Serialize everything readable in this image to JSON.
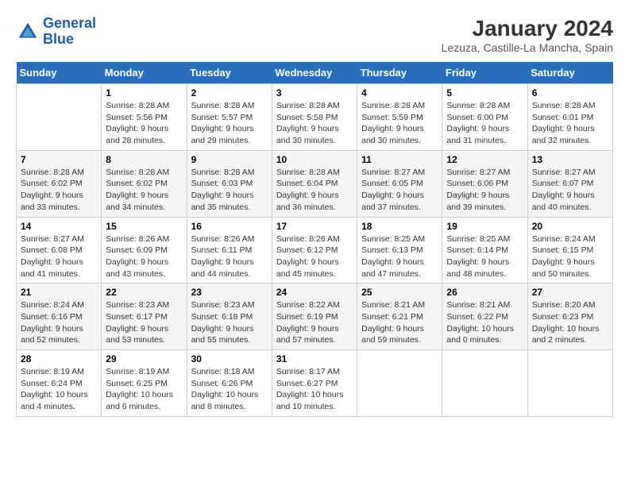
{
  "logo": {
    "line1": "General",
    "line2": "Blue"
  },
  "title": "January 2024",
  "subtitle": "Lezuza, Castille-La Mancha, Spain",
  "days_header": [
    "Sunday",
    "Monday",
    "Tuesday",
    "Wednesday",
    "Thursday",
    "Friday",
    "Saturday"
  ],
  "weeks": [
    [
      {
        "day": "",
        "sunrise": "",
        "sunset": "",
        "daylight": ""
      },
      {
        "day": "1",
        "sunrise": "Sunrise: 8:28 AM",
        "sunset": "Sunset: 5:56 PM",
        "daylight": "Daylight: 9 hours and 28 minutes."
      },
      {
        "day": "2",
        "sunrise": "Sunrise: 8:28 AM",
        "sunset": "Sunset: 5:57 PM",
        "daylight": "Daylight: 9 hours and 29 minutes."
      },
      {
        "day": "3",
        "sunrise": "Sunrise: 8:28 AM",
        "sunset": "Sunset: 5:58 PM",
        "daylight": "Daylight: 9 hours and 30 minutes."
      },
      {
        "day": "4",
        "sunrise": "Sunrise: 8:28 AM",
        "sunset": "Sunset: 5:59 PM",
        "daylight": "Daylight: 9 hours and 30 minutes."
      },
      {
        "day": "5",
        "sunrise": "Sunrise: 8:28 AM",
        "sunset": "Sunset: 6:00 PM",
        "daylight": "Daylight: 9 hours and 31 minutes."
      },
      {
        "day": "6",
        "sunrise": "Sunrise: 8:28 AM",
        "sunset": "Sunset: 6:01 PM",
        "daylight": "Daylight: 9 hours and 32 minutes."
      }
    ],
    [
      {
        "day": "7",
        "sunrise": "Sunrise: 8:28 AM",
        "sunset": "Sunset: 6:02 PM",
        "daylight": "Daylight: 9 hours and 33 minutes."
      },
      {
        "day": "8",
        "sunrise": "Sunrise: 8:28 AM",
        "sunset": "Sunset: 6:02 PM",
        "daylight": "Daylight: 9 hours and 34 minutes."
      },
      {
        "day": "9",
        "sunrise": "Sunrise: 8:28 AM",
        "sunset": "Sunset: 6:03 PM",
        "daylight": "Daylight: 9 hours and 35 minutes."
      },
      {
        "day": "10",
        "sunrise": "Sunrise: 8:28 AM",
        "sunset": "Sunset: 6:04 PM",
        "daylight": "Daylight: 9 hours and 36 minutes."
      },
      {
        "day": "11",
        "sunrise": "Sunrise: 8:27 AM",
        "sunset": "Sunset: 6:05 PM",
        "daylight": "Daylight: 9 hours and 37 minutes."
      },
      {
        "day": "12",
        "sunrise": "Sunrise: 8:27 AM",
        "sunset": "Sunset: 6:06 PM",
        "daylight": "Daylight: 9 hours and 39 minutes."
      },
      {
        "day": "13",
        "sunrise": "Sunrise: 8:27 AM",
        "sunset": "Sunset: 6:07 PM",
        "daylight": "Daylight: 9 hours and 40 minutes."
      }
    ],
    [
      {
        "day": "14",
        "sunrise": "Sunrise: 8:27 AM",
        "sunset": "Sunset: 6:08 PM",
        "daylight": "Daylight: 9 hours and 41 minutes."
      },
      {
        "day": "15",
        "sunrise": "Sunrise: 8:26 AM",
        "sunset": "Sunset: 6:09 PM",
        "daylight": "Daylight: 9 hours and 43 minutes."
      },
      {
        "day": "16",
        "sunrise": "Sunrise: 8:26 AM",
        "sunset": "Sunset: 6:11 PM",
        "daylight": "Daylight: 9 hours and 44 minutes."
      },
      {
        "day": "17",
        "sunrise": "Sunrise: 8:26 AM",
        "sunset": "Sunset: 6:12 PM",
        "daylight": "Daylight: 9 hours and 45 minutes."
      },
      {
        "day": "18",
        "sunrise": "Sunrise: 8:25 AM",
        "sunset": "Sunset: 6:13 PM",
        "daylight": "Daylight: 9 hours and 47 minutes."
      },
      {
        "day": "19",
        "sunrise": "Sunrise: 8:25 AM",
        "sunset": "Sunset: 6:14 PM",
        "daylight": "Daylight: 9 hours and 48 minutes."
      },
      {
        "day": "20",
        "sunrise": "Sunrise: 8:24 AM",
        "sunset": "Sunset: 6:15 PM",
        "daylight": "Daylight: 9 hours and 50 minutes."
      }
    ],
    [
      {
        "day": "21",
        "sunrise": "Sunrise: 8:24 AM",
        "sunset": "Sunset: 6:16 PM",
        "daylight": "Daylight: 9 hours and 52 minutes."
      },
      {
        "day": "22",
        "sunrise": "Sunrise: 8:23 AM",
        "sunset": "Sunset: 6:17 PM",
        "daylight": "Daylight: 9 hours and 53 minutes."
      },
      {
        "day": "23",
        "sunrise": "Sunrise: 8:23 AM",
        "sunset": "Sunset: 6:18 PM",
        "daylight": "Daylight: 9 hours and 55 minutes."
      },
      {
        "day": "24",
        "sunrise": "Sunrise: 8:22 AM",
        "sunset": "Sunset: 6:19 PM",
        "daylight": "Daylight: 9 hours and 57 minutes."
      },
      {
        "day": "25",
        "sunrise": "Sunrise: 8:21 AM",
        "sunset": "Sunset: 6:21 PM",
        "daylight": "Daylight: 9 hours and 59 minutes."
      },
      {
        "day": "26",
        "sunrise": "Sunrise: 8:21 AM",
        "sunset": "Sunset: 6:22 PM",
        "daylight": "Daylight: 10 hours and 0 minutes."
      },
      {
        "day": "27",
        "sunrise": "Sunrise: 8:20 AM",
        "sunset": "Sunset: 6:23 PM",
        "daylight": "Daylight: 10 hours and 2 minutes."
      }
    ],
    [
      {
        "day": "28",
        "sunrise": "Sunrise: 8:19 AM",
        "sunset": "Sunset: 6:24 PM",
        "daylight": "Daylight: 10 hours and 4 minutes."
      },
      {
        "day": "29",
        "sunrise": "Sunrise: 8:19 AM",
        "sunset": "Sunset: 6:25 PM",
        "daylight": "Daylight: 10 hours and 6 minutes."
      },
      {
        "day": "30",
        "sunrise": "Sunrise: 8:18 AM",
        "sunset": "Sunset: 6:26 PM",
        "daylight": "Daylight: 10 hours and 8 minutes."
      },
      {
        "day": "31",
        "sunrise": "Sunrise: 8:17 AM",
        "sunset": "Sunset: 6:27 PM",
        "daylight": "Daylight: 10 hours and 10 minutes."
      },
      {
        "day": "",
        "sunrise": "",
        "sunset": "",
        "daylight": ""
      },
      {
        "day": "",
        "sunrise": "",
        "sunset": "",
        "daylight": ""
      },
      {
        "day": "",
        "sunrise": "",
        "sunset": "",
        "daylight": ""
      }
    ]
  ]
}
